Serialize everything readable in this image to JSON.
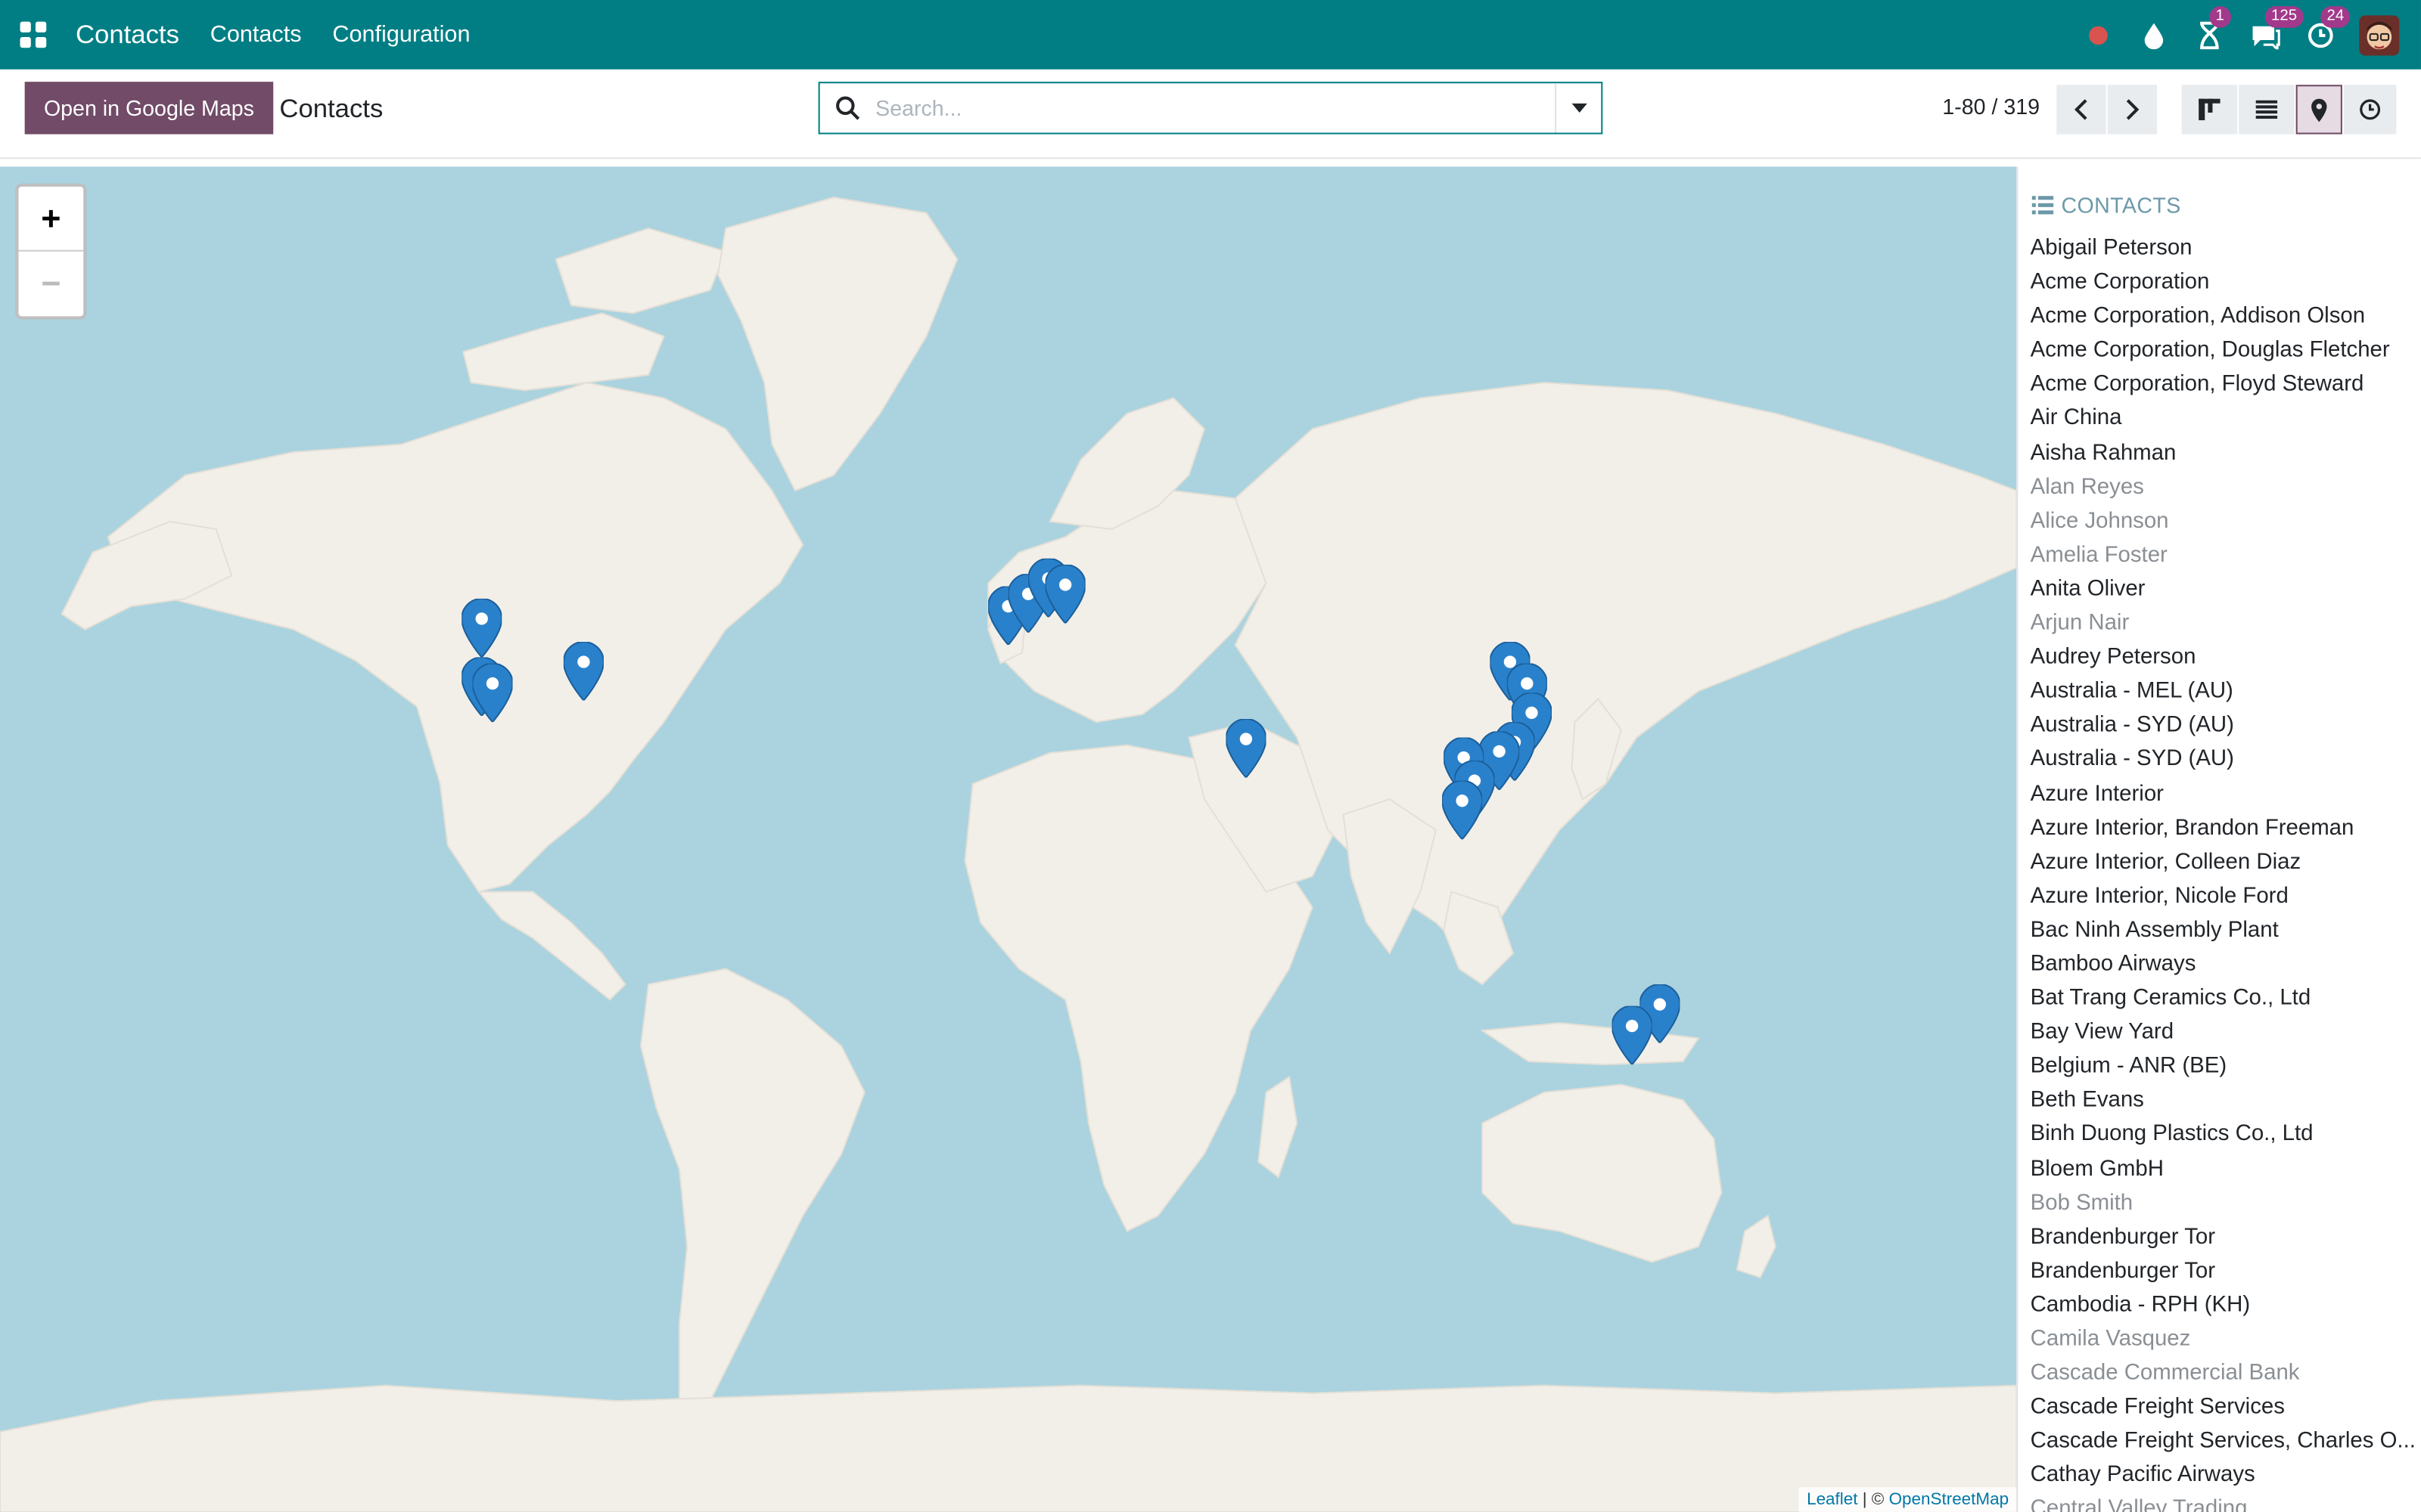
{
  "navbar": {
    "app_name": "Contacts",
    "menu": [
      "Contacts",
      "Configuration"
    ],
    "badges": {
      "activities": "1",
      "messages": "125",
      "clock": "24"
    }
  },
  "control": {
    "gmaps_label": "Open in Google Maps",
    "breadcrumb": "Contacts",
    "search_placeholder": "Search...",
    "pager": "1-80 / 319"
  },
  "map": {
    "zoom_in": "+",
    "zoom_out": "−",
    "attribution_leaflet": "Leaflet",
    "attribution_sep": " | © ",
    "attribution_osm": "OpenStreetMap"
  },
  "sidebar": {
    "title": "CONTACTS",
    "items": [
      {
        "name": "Abigail Peterson",
        "muted": false
      },
      {
        "name": "Acme Corporation",
        "muted": false
      },
      {
        "name": "Acme Corporation, Addison Olson",
        "muted": false
      },
      {
        "name": "Acme Corporation, Douglas Fletcher",
        "muted": false
      },
      {
        "name": "Acme Corporation, Floyd Steward",
        "muted": false
      },
      {
        "name": "Air China",
        "muted": false
      },
      {
        "name": "Aisha Rahman",
        "muted": false
      },
      {
        "name": "Alan Reyes",
        "muted": true
      },
      {
        "name": "Alice Johnson",
        "muted": true
      },
      {
        "name": "Amelia Foster",
        "muted": true
      },
      {
        "name": "Anita Oliver",
        "muted": false
      },
      {
        "name": "Arjun Nair",
        "muted": true
      },
      {
        "name": "Audrey Peterson",
        "muted": false
      },
      {
        "name": "Australia - MEL (AU)",
        "muted": false
      },
      {
        "name": "Australia - SYD (AU)",
        "muted": false
      },
      {
        "name": "Australia - SYD (AU)",
        "muted": false
      },
      {
        "name": "Azure Interior",
        "muted": false
      },
      {
        "name": "Azure Interior, Brandon Freeman",
        "muted": false
      },
      {
        "name": "Azure Interior, Colleen Diaz",
        "muted": false
      },
      {
        "name": "Azure Interior, Nicole Ford",
        "muted": false
      },
      {
        "name": "Bac Ninh Assembly Plant",
        "muted": false
      },
      {
        "name": "Bamboo Airways",
        "muted": false
      },
      {
        "name": "Bat Trang Ceramics Co., Ltd",
        "muted": false
      },
      {
        "name": "Bay View Yard",
        "muted": false
      },
      {
        "name": "Belgium - ANR (BE)",
        "muted": false
      },
      {
        "name": "Beth Evans",
        "muted": false
      },
      {
        "name": "Binh Duong Plastics Co., Ltd",
        "muted": false
      },
      {
        "name": "Bloem GmbH",
        "muted": false
      },
      {
        "name": "Bob Smith",
        "muted": true
      },
      {
        "name": "Brandenburger Tor",
        "muted": false
      },
      {
        "name": "Brandenburger Tor",
        "muted": false
      },
      {
        "name": "Cambodia - RPH (KH)",
        "muted": false
      },
      {
        "name": "Camila Vasquez",
        "muted": true
      },
      {
        "name": "Cascade Commercial Bank",
        "muted": true
      },
      {
        "name": "Cascade Freight Services",
        "muted": false
      },
      {
        "name": "Cascade Freight Services, Charles O...",
        "muted": false
      },
      {
        "name": "Cathay Pacific Airways",
        "muted": false
      },
      {
        "name": "Central Valley Trading",
        "muted": true
      }
    ]
  },
  "colors": {
    "navbar": "#017e84",
    "primary_button": "#714b67",
    "water": "#aad3df",
    "land": "#f2efe9",
    "marker": "#2a81cb"
  }
}
